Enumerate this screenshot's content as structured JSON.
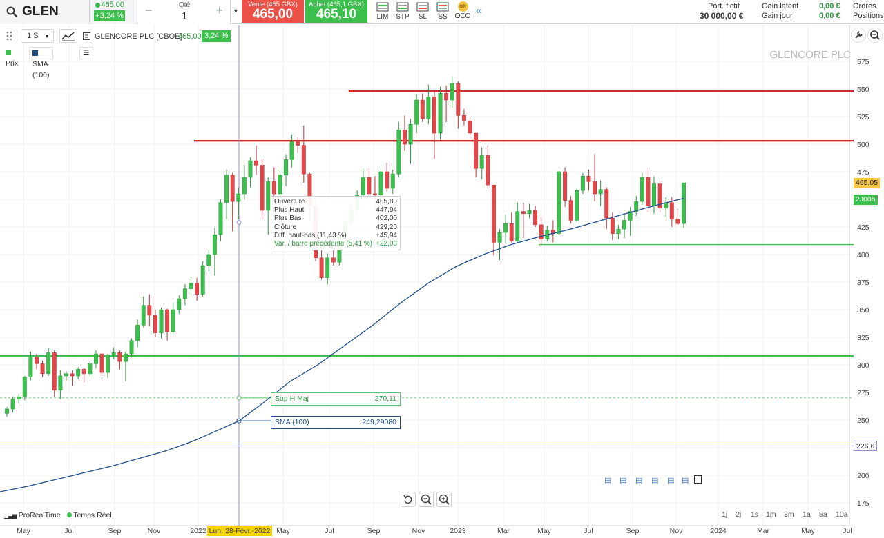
{
  "header": {
    "ticker": "GLEN",
    "last_price": "465,00",
    "change_pct": "+3,24 %",
    "qty_label": "Qté",
    "qty_value": "1",
    "sell_label": "Vente (465 GBX)",
    "sell_price": "465,00",
    "buy_label": "Achat (465,1 GBX)",
    "buy_price": "465,10",
    "order_tools": [
      "LIM",
      "STP",
      "SL",
      "SS",
      "OCO"
    ],
    "oco_badge": "OR",
    "portfolio_label": "Port. fictif",
    "portfolio_value": "30 000,00 €",
    "gain_latent_label": "Gain latent",
    "gain_latent_value": "0,00 €",
    "gain_jour_label": "Gain jour",
    "gain_jour_value": "0,00 €",
    "orders_label": "Ordres",
    "positions_label": "Positions"
  },
  "chart_toolbar": {
    "interval": "1 S",
    "instrument": "GLENCORE PLC [CBOE]",
    "instrument_price": "465,00",
    "instrument_change": "3,24 %",
    "legend": [
      {
        "label": "Prix",
        "color": "#3cbf4d"
      },
      {
        "label": "SMA (100)",
        "color": "#1f4d8c"
      }
    ]
  },
  "chart_data": {
    "type": "candlestick",
    "title": "GLENCORE PLC",
    "watermark": "GLENCORE PLC",
    "ylim": [
      165,
      585
    ],
    "y_ticks": [
      175,
      200,
      225,
      250,
      275,
      300,
      325,
      350,
      375,
      400,
      425,
      450,
      475,
      500,
      525,
      550,
      575
    ],
    "x_ticks": [
      "May",
      "Jul",
      "Sep",
      "Nov",
      "2022",
      "May",
      "Jul",
      "Sep",
      "Nov",
      "2023",
      "Mar",
      "May",
      "Jul",
      "Sep",
      "Nov",
      "2024",
      "Mar",
      "May",
      "Jul"
    ],
    "crosshair_label": "Lun. 28-Févr.-2022",
    "candles": [
      [
        256,
        262,
        253,
        260
      ],
      [
        260,
        271,
        257,
        269
      ],
      [
        269,
        274,
        265,
        271
      ],
      [
        271,
        290,
        268,
        289
      ],
      [
        289,
        312,
        286,
        307
      ],
      [
        307,
        310,
        296,
        301
      ],
      [
        301,
        304,
        289,
        292
      ],
      [
        292,
        315,
        290,
        311
      ],
      [
        311,
        313,
        271,
        277
      ],
      [
        277,
        295,
        269,
        290
      ],
      [
        290,
        294,
        286,
        292
      ],
      [
        292,
        295,
        281,
        290
      ],
      [
        290,
        298,
        287,
        296
      ],
      [
        296,
        297,
        284,
        292
      ],
      [
        292,
        303,
        289,
        301
      ],
      [
        301,
        313,
        297,
        310
      ],
      [
        310,
        310,
        290,
        293
      ],
      [
        293,
        310,
        288,
        309
      ],
      [
        309,
        316,
        305,
        311
      ],
      [
        311,
        313,
        296,
        303
      ],
      [
        303,
        312,
        285,
        310
      ],
      [
        310,
        324,
        307,
        322
      ],
      [
        322,
        341,
        316,
        336
      ],
      [
        336,
        362,
        334,
        354
      ],
      [
        354,
        364,
        335,
        345
      ],
      [
        345,
        350,
        325,
        329
      ],
      [
        329,
        352,
        324,
        350
      ],
      [
        350,
        351,
        322,
        330
      ],
      [
        330,
        357,
        327,
        350
      ],
      [
        350,
        363,
        346,
        360
      ],
      [
        360,
        373,
        354,
        369
      ],
      [
        369,
        380,
        364,
        374
      ],
      [
        374,
        379,
        358,
        364
      ],
      [
        364,
        394,
        362,
        390
      ],
      [
        390,
        405,
        385,
        400
      ],
      [
        400,
        424,
        381,
        418
      ],
      [
        418,
        450,
        412,
        447
      ],
      [
        447,
        477,
        432,
        472
      ],
      [
        472,
        474,
        421,
        448
      ],
      [
        448,
        461,
        432,
        455
      ],
      [
        455,
        481,
        450,
        470
      ],
      [
        470,
        488,
        461,
        485
      ],
      [
        485,
        499,
        472,
        481
      ],
      [
        481,
        487,
        432,
        440
      ],
      [
        440,
        470,
        418,
        466
      ],
      [
        466,
        479,
        438,
        455
      ],
      [
        455,
        477,
        445,
        472
      ],
      [
        472,
        491,
        462,
        486
      ],
      [
        486,
        509,
        479,
        502
      ],
      [
        502,
        506,
        492,
        499
      ],
      [
        499,
        517,
        465,
        473
      ],
      [
        473,
        474,
        430,
        444
      ],
      [
        444,
        452,
        394,
        397
      ],
      [
        397,
        412,
        377,
        379
      ],
      [
        379,
        401,
        373,
        397
      ],
      [
        397,
        406,
        390,
        393
      ],
      [
        393,
        415,
        390,
        416
      ],
      [
        416,
        435,
        405,
        430
      ],
      [
        430,
        448,
        426,
        441
      ],
      [
        441,
        458,
        432,
        454
      ],
      [
        454,
        478,
        450,
        470
      ],
      [
        470,
        478,
        452,
        455
      ],
      [
        455,
        471,
        440,
        454
      ],
      [
        454,
        478,
        450,
        475
      ],
      [
        475,
        483,
        457,
        460
      ],
      [
        460,
        477,
        455,
        473
      ],
      [
        473,
        520,
        470,
        513
      ],
      [
        513,
        526,
        494,
        500
      ],
      [
        500,
        523,
        482,
        518
      ],
      [
        518,
        545,
        510,
        540
      ],
      [
        540,
        546,
        520,
        523
      ],
      [
        523,
        554,
        518,
        543
      ],
      [
        543,
        549,
        487,
        510
      ],
      [
        510,
        552,
        504,
        546
      ],
      [
        546,
        553,
        520,
        540
      ],
      [
        540,
        561,
        533,
        555
      ],
      [
        555,
        557,
        514,
        526
      ],
      [
        526,
        532,
        517,
        521
      ],
      [
        521,
        525,
        507,
        510
      ],
      [
        510,
        510,
        470,
        478
      ],
      [
        478,
        497,
        468,
        490
      ],
      [
        490,
        499,
        460,
        463
      ],
      [
        463,
        463,
        399,
        411
      ],
      [
        411,
        423,
        395,
        420
      ],
      [
        420,
        436,
        410,
        428
      ],
      [
        428,
        438,
        411,
        412
      ],
      [
        412,
        447,
        410,
        439
      ],
      [
        439,
        447,
        415,
        437
      ],
      [
        437,
        446,
        433,
        440
      ],
      [
        440,
        444,
        425,
        427
      ],
      [
        427,
        434,
        409,
        414
      ],
      [
        414,
        426,
        412,
        422
      ],
      [
        422,
        431,
        411,
        419
      ],
      [
        419,
        477,
        418,
        475
      ],
      [
        475,
        479,
        443,
        449
      ],
      [
        449,
        453,
        428,
        431
      ],
      [
        431,
        460,
        429,
        458
      ],
      [
        458,
        474,
        455,
        471
      ],
      [
        471,
        477,
        458,
        466
      ],
      [
        466,
        491,
        448,
        455
      ],
      [
        455,
        467,
        444,
        459
      ],
      [
        459,
        461,
        423,
        433
      ],
      [
        433,
        438,
        413,
        419
      ],
      [
        419,
        427,
        414,
        423
      ],
      [
        423,
        437,
        415,
        431
      ],
      [
        431,
        443,
        417,
        439
      ],
      [
        439,
        453,
        435,
        448
      ],
      [
        448,
        474,
        445,
        470
      ],
      [
        470,
        479,
        438,
        444
      ],
      [
        444,
        471,
        437,
        464
      ],
      [
        464,
        467,
        438,
        442
      ],
      [
        442,
        452,
        434,
        447
      ],
      [
        447,
        452,
        425,
        432
      ],
      [
        432,
        441,
        427,
        428
      ],
      [
        428,
        465,
        424,
        465
      ]
    ],
    "sma_100": [
      [
        0,
        185
      ],
      [
        40,
        190
      ],
      [
        80,
        196
      ],
      [
        120,
        202
      ],
      [
        160,
        208
      ],
      [
        200,
        215
      ],
      [
        240,
        222
      ],
      [
        280,
        231
      ],
      [
        320,
        242
      ],
      [
        346,
        249.29
      ],
      [
        380,
        265
      ],
      [
        420,
        285
      ],
      [
        460,
        300
      ],
      [
        500,
        318
      ],
      [
        540,
        336
      ],
      [
        580,
        356
      ],
      [
        620,
        374
      ],
      [
        660,
        389
      ],
      [
        700,
        400
      ],
      [
        740,
        409
      ],
      [
        780,
        416
      ],
      [
        820,
        422
      ],
      [
        860,
        429
      ],
      [
        900,
        436
      ],
      [
        940,
        443
      ],
      [
        990,
        451
      ]
    ],
    "horizontal_lines": [
      {
        "value": 548,
        "color": "#d62a2a",
        "x_start": 505
      },
      {
        "value": 503,
        "color": "#d62a2a",
        "x_start": 281
      },
      {
        "value": 409,
        "color": "#3cbf4d",
        "x_start": 780
      },
      {
        "value": 308,
        "color": "#3cbf4d",
        "x_start": 0
      },
      {
        "value": 270.11,
        "color": "#7acb83",
        "x_start": 0,
        "dashed": true
      },
      {
        "value": 226.6,
        "color": "#8f8fe6",
        "x_start": 0
      }
    ],
    "price_tags": [
      {
        "label": "465,05",
        "value": 465,
        "bg": "#f5c642",
        "fg": "#222"
      },
      {
        "label": "2J00h",
        "value": 450,
        "bg": "#3cbf4d",
        "fg": "#fff"
      },
      {
        "label": "226,6",
        "value": 226.6,
        "bg": "#fff",
        "fg": "#333"
      }
    ]
  },
  "tooltip": {
    "rows": [
      {
        "k": "Ouverture",
        "v": "405,80"
      },
      {
        "k": "Plus Haut",
        "v": "447,94"
      },
      {
        "k": "Plus Bas",
        "v": "402,00"
      },
      {
        "k": "Clôture",
        "v": "429,20"
      },
      {
        "k": "Diff. haut-bas (11,43 %)",
        "v": "+45,94"
      },
      {
        "k": "Var. / barre précédente (5,41 %)",
        "v": "+22,03"
      }
    ]
  },
  "tags": {
    "sup_label": "Sup H Maj",
    "sup_value": "270,11",
    "sma_label": "SMA (100)",
    "sma_value": "249,29080"
  },
  "footer": {
    "brand": "ProRealTime",
    "realtime": "Temps Réel",
    "periods": [
      "1j",
      "2j",
      "1s",
      "1m",
      "3m",
      "1a",
      "5a",
      "10a"
    ]
  }
}
